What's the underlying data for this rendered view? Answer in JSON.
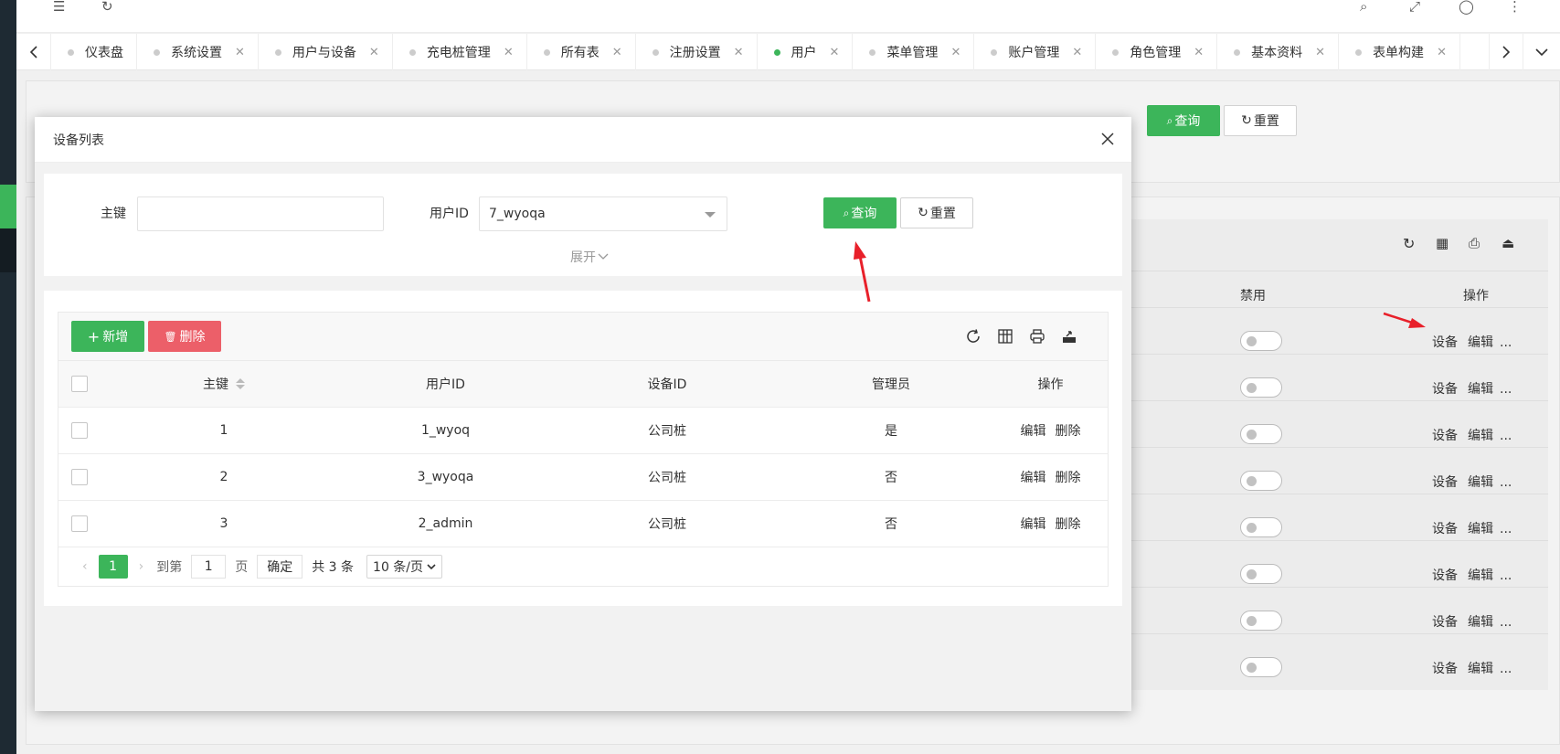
{
  "tabs": [
    {
      "label": "仪表盘",
      "active": false,
      "closable": false
    },
    {
      "label": "系统设置",
      "active": false,
      "closable": true
    },
    {
      "label": "用户与设备",
      "active": false,
      "closable": true
    },
    {
      "label": "充电桩管理",
      "active": false,
      "closable": true
    },
    {
      "label": "所有表",
      "active": false,
      "closable": true
    },
    {
      "label": "注册设置",
      "active": false,
      "closable": true
    },
    {
      "label": "用户",
      "active": true,
      "closable": true
    },
    {
      "label": "菜单管理",
      "active": false,
      "closable": true
    },
    {
      "label": "账户管理",
      "active": false,
      "closable": true
    },
    {
      "label": "角色管理",
      "active": false,
      "closable": true
    },
    {
      "label": "基本资料",
      "active": false,
      "closable": true
    },
    {
      "label": "表单构建",
      "active": false,
      "closable": true
    }
  ],
  "background": {
    "search_button": "查询",
    "reset_button": "重置",
    "col_disabled": "禁用",
    "col_actions": "操作",
    "row_actions": {
      "device": "设备",
      "edit": "编辑",
      "more": "..."
    },
    "row_count": 8
  },
  "modal": {
    "title": "设备列表",
    "search": {
      "id_label": "主键",
      "id_value": "",
      "user_label": "用户ID",
      "user_value": "7_wyoqa",
      "search_button": "查询",
      "reset_button": "重置",
      "expand": "展开"
    },
    "toolbar": {
      "add_button": "新增",
      "delete_button": "删除"
    },
    "table": {
      "columns": [
        "主键",
        "用户ID",
        "设备ID",
        "管理员",
        "操作"
      ],
      "rows": [
        {
          "id": "1",
          "user": "1_wyoq",
          "device": "公司桩",
          "admin": "是"
        },
        {
          "id": "2",
          "user": "3_wyoqa",
          "device": "公司桩",
          "admin": "否"
        },
        {
          "id": "3",
          "user": "2_admin",
          "device": "公司桩",
          "admin": "否"
        }
      ],
      "row_edit": "编辑",
      "row_delete": "删除"
    },
    "pager": {
      "current": "1",
      "goto_label": "到第",
      "goto_value": "1",
      "page_label": "页",
      "confirm": "确定",
      "total": "共 3 条",
      "page_size": "10 条/页"
    }
  },
  "colors": {
    "primary": "#3cb55a",
    "danger": "#ec5f69",
    "annotation": "#e8202a"
  }
}
